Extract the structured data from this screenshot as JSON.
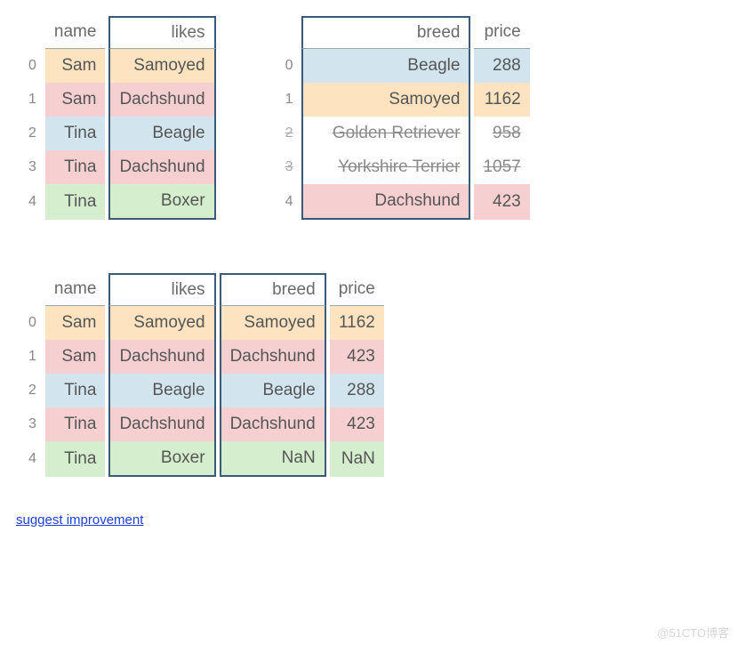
{
  "tableA": {
    "headers": {
      "idx": "",
      "name": "name",
      "likes": "likes"
    },
    "rows": [
      {
        "idx": "0",
        "name": "Sam",
        "likes": "Samoyed",
        "cls": "orange"
      },
      {
        "idx": "1",
        "name": "Sam",
        "likes": "Dachshund",
        "cls": "pink"
      },
      {
        "idx": "2",
        "name": "Tina",
        "likes": "Beagle",
        "cls": "blue"
      },
      {
        "idx": "3",
        "name": "Tina",
        "likes": "Dachshund",
        "cls": "pink"
      },
      {
        "idx": "4",
        "name": "Tina",
        "likes": "Boxer",
        "cls": "green"
      }
    ]
  },
  "tableB": {
    "headers": {
      "idx": "",
      "breed": "breed",
      "price": "price"
    },
    "rows": [
      {
        "idx": "0",
        "breed": "Beagle",
        "price": "288",
        "cls": "blue"
      },
      {
        "idx": "1",
        "breed": "Samoyed",
        "price": "1162",
        "cls": "orange"
      },
      {
        "idx": "2",
        "breed": "Golden Retriever",
        "price": "958",
        "cls": "white strike"
      },
      {
        "idx": "3",
        "breed": "Yorkshire Terrier",
        "price": "1057",
        "cls": "white strike"
      },
      {
        "idx": "4",
        "breed": "Dachshund",
        "price": "423",
        "cls": "pink"
      }
    ]
  },
  "tableC": {
    "headers": {
      "idx": "",
      "name": "name",
      "likes": "likes",
      "breed": "breed",
      "price": "price"
    },
    "rows": [
      {
        "idx": "0",
        "name": "Sam",
        "likes": "Samoyed",
        "breed": "Samoyed",
        "price": "1162",
        "cls": "orange"
      },
      {
        "idx": "1",
        "name": "Sam",
        "likes": "Dachshund",
        "breed": "Dachshund",
        "price": "423",
        "cls": "pink"
      },
      {
        "idx": "2",
        "name": "Tina",
        "likes": "Beagle",
        "breed": "Beagle",
        "price": "288",
        "cls": "blue"
      },
      {
        "idx": "3",
        "name": "Tina",
        "likes": "Dachshund",
        "breed": "Dachshund",
        "price": "423",
        "cls": "pink"
      },
      {
        "idx": "4",
        "name": "Tina",
        "likes": "Boxer",
        "breed": "NaN",
        "price": "NaN",
        "cls": "green"
      }
    ]
  },
  "link": {
    "suggest": "suggest improvement"
  },
  "watermark": "@51CTO博客"
}
